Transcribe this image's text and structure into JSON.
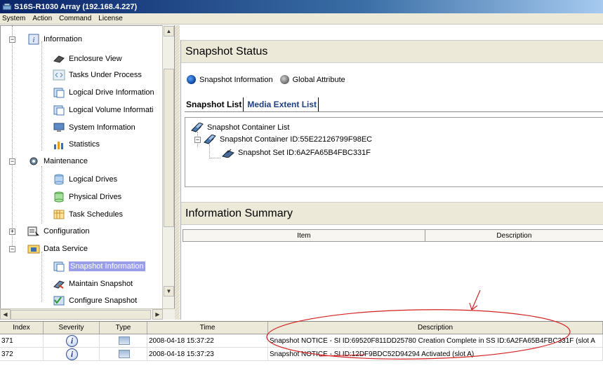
{
  "window": {
    "title": "S16S-R1030 Array (192.168.4.227)"
  },
  "menu": [
    "System",
    "Action",
    "Command",
    "License"
  ],
  "tree": {
    "information": "Information",
    "enclosure_view": "Enclosure View",
    "tasks_under_process": "Tasks Under Process",
    "logical_drive_information": "Logical Drive Information",
    "logical_volume_information": "Logical Volume Informati",
    "system_information": "System Information",
    "statistics": "Statistics",
    "maintenance": "Maintenance",
    "logical_drives": "Logical Drives",
    "physical_drives": "Physical Drives",
    "task_schedules": "Task Schedules",
    "configuration": "Configuration",
    "data_service": "Data Service",
    "snapshot_information": "Snapshot Information",
    "maintain_snapshot": "Maintain Snapshot",
    "configure_snapshot": "Configure Snapshot"
  },
  "snapshot_status": {
    "heading": "Snapshot Status",
    "radio_snapshot_info": "Snapshot Information",
    "radio_global_attr": "Global Attribute",
    "tab_snapshot_list": "Snapshot List",
    "tab_media_extent_list": "Media Extent List",
    "container_list": "Snapshot Container List",
    "container_id": "Snapshot Container ID:55E22126799F98EC",
    "set_id": "Snapshot Set ID:6A2FA65B4FBC331F"
  },
  "info_summary": {
    "heading": "Information Summary",
    "col_item": "Item",
    "col_description": "Description"
  },
  "log": {
    "headers": {
      "index": "Index",
      "severity": "Severity",
      "type": "Type",
      "time": "Time",
      "description": "Description"
    },
    "rows": [
      {
        "index": "371",
        "time": "2008-04-18 15:37:22",
        "description": "Snapshot NOTICE - SI ID:69520F811DD25780 Creation Complete in SS ID:6A2FA65B4FBC331F (slot A"
      },
      {
        "index": "372",
        "time": "2008-04-18 15:37:23",
        "description": "Snapshot NOTICE - SI ID:12DF9BDC52D94294 Activated (slot A)"
      }
    ]
  }
}
